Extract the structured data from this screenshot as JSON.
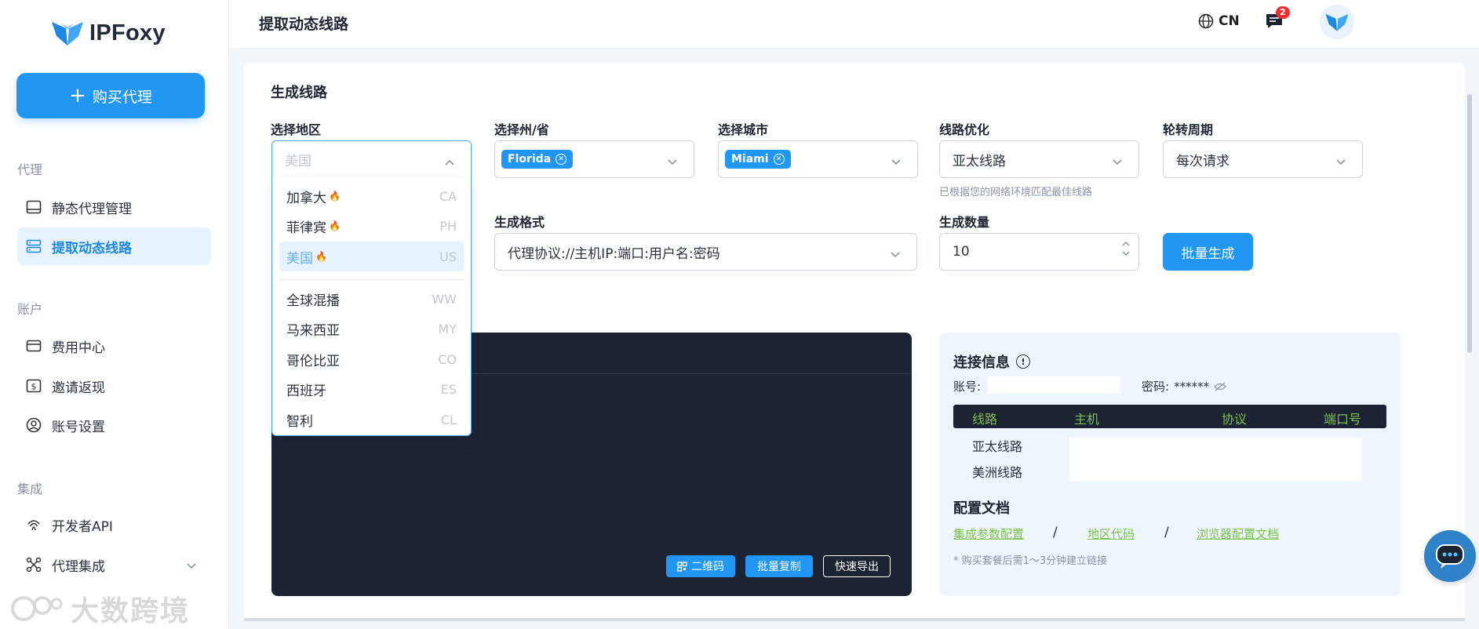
{
  "logo_text": "IPFoxy",
  "buy_button": "购买代理",
  "sidebar": {
    "section_proxy": "代理",
    "section_account": "账户",
    "section_integration": "集成",
    "items": [
      {
        "label": "静态代理管理"
      },
      {
        "label": "提取动态线路"
      },
      {
        "label": "费用中心"
      },
      {
        "label": "邀请返现"
      },
      {
        "label": "账号设置"
      },
      {
        "label": "开发者API"
      },
      {
        "label": "代理集成"
      }
    ]
  },
  "watermark": "大数跨境",
  "header": {
    "title": "提取动态线路",
    "lang": "CN",
    "message_count": "2"
  },
  "form": {
    "section_title": "生成线路",
    "region_label": "选择地区",
    "region_placeholder": "美国",
    "state_label": "选择州/省",
    "state_tag": "Florida",
    "city_label": "选择城市",
    "city_tag": "Miami",
    "route_opt_label": "线路优化",
    "route_opt_value": "亚太线路",
    "route_hint": "已根据您的网络环境匹配最佳线路",
    "rotation_label": "轮转周期",
    "rotation_value": "每次请求",
    "format_label": "生成格式",
    "format_value": "代理协议://主机IP:端口:用户名:密码",
    "count_label": "生成数量",
    "count_value": "10",
    "generate_button": "批量生成"
  },
  "region_dropdown": [
    {
      "name": "加拿大",
      "code": "CA",
      "hot": true
    },
    {
      "name": "菲律宾",
      "code": "PH",
      "hot": true
    },
    {
      "name": "美国",
      "code": "US",
      "hot": true,
      "selected": true
    },
    {
      "name": "全球混播",
      "code": "WW"
    },
    {
      "name": "马来西亚",
      "code": "MY"
    },
    {
      "name": "哥伦比亚",
      "code": "CO"
    },
    {
      "name": "西班牙",
      "code": "ES"
    },
    {
      "name": "智利",
      "code": "CL"
    }
  ],
  "output_panel": {
    "qr_button": "二维码",
    "copy_button": "批量复制",
    "export_button": "快速导出"
  },
  "connection": {
    "title": "连接信息",
    "account_label": "账号:",
    "password_label": "密码:",
    "password_mask": "******",
    "columns": [
      "线路",
      "主机",
      "协议",
      "端口号"
    ],
    "routes": [
      "亚太线路",
      "美洲线路"
    ],
    "docs_title": "配置文档",
    "links": [
      "集成参数配置",
      "地区代码",
      "浏览器配置文档"
    ],
    "separator": "/",
    "note": "* 购买套餐后需1～3分钟建立链接"
  },
  "colors": {
    "primary": "#2196f3",
    "dark_panel": "#1c2333",
    "link_green": "#7ac34a"
  }
}
